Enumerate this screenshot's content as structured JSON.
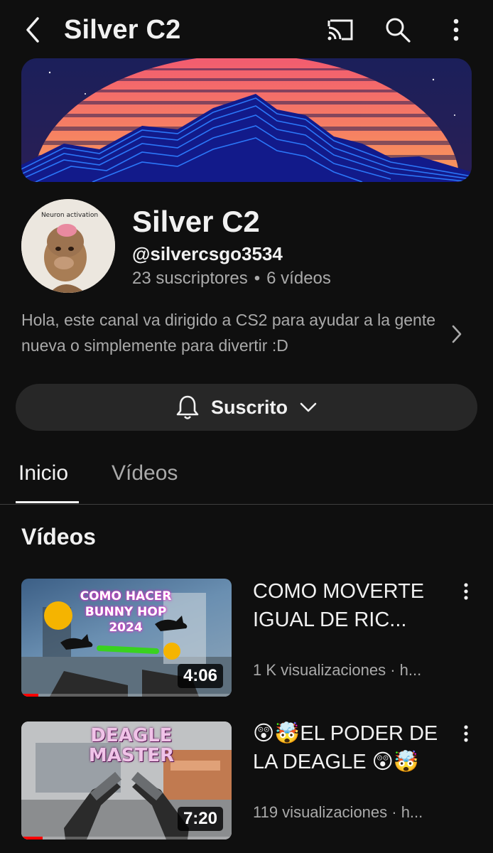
{
  "header": {
    "title": "Silver C2",
    "back_icon": "chevron-left-icon",
    "cast_icon": "cast-icon",
    "search_icon": "search-icon",
    "more_icon": "more-vertical-icon"
  },
  "channel": {
    "name": "Silver C2",
    "handle": "@silvercsgo3534",
    "subscribers": "23 suscriptores",
    "videos_count": "6 vídeos",
    "separator": "•",
    "avatar_caption": "Neuron activation",
    "description": "Hola, este canal va dirigido a CS2 para ayudar a la gente nueva o simplemente para divertir :D"
  },
  "subscribe": {
    "label": "Suscrito",
    "bell_icon": "bell-icon",
    "dropdown_icon": "chevron-down-icon"
  },
  "tabs": [
    {
      "label": "Inicio",
      "active": true
    },
    {
      "label": "Vídeos",
      "active": false
    }
  ],
  "section": {
    "title": "Vídeos"
  },
  "videos": [
    {
      "title": "COMO MOVERTE IGUAL DE RIC...",
      "meta": "1 K visualizaciones · h...",
      "duration": "4:06",
      "thumb_text": [
        "COMO HACER",
        "BUNNY HOP",
        "2024"
      ],
      "progress": 0.08
    },
    {
      "title": "😲🤯EL PODER DE LA DEAGLE 😲🤯",
      "meta": "119 visualizaciones · h...",
      "duration": "7:20",
      "thumb_text": [
        "DEAGLE",
        "MASTER"
      ],
      "progress": 0.1
    }
  ],
  "colors": {
    "background": "#0f0f0f",
    "text_primary": "#f1f1f1",
    "text_secondary": "#aaaaaa",
    "button_bg": "#272727",
    "progress_red": "#ff0000"
  }
}
